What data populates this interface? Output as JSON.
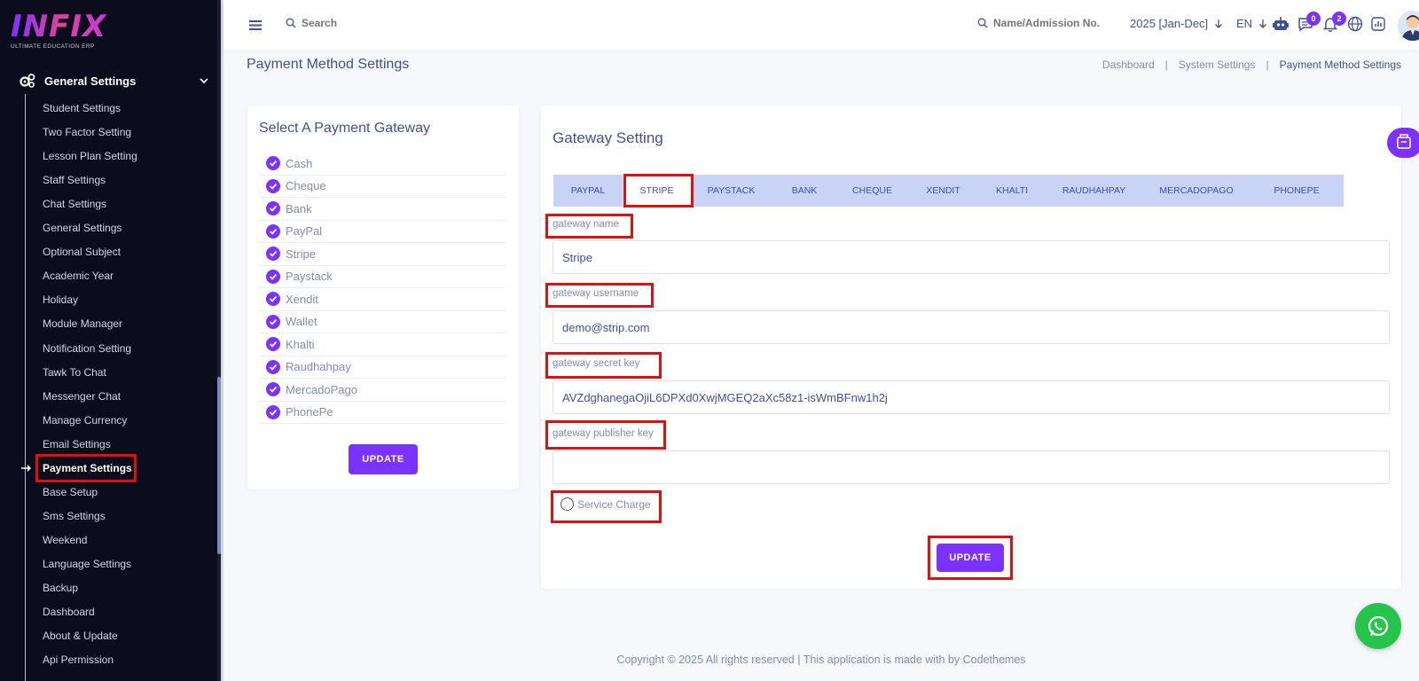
{
  "sidebar": {
    "logo_text": "INFIX",
    "logo_sub": "ULTIMATE EDUCATION ERP",
    "group_label": "General Settings",
    "items": [
      "Student Settings",
      "Two Factor Setting",
      "Lesson Plan Setting",
      "Staff Settings",
      "Chat Settings",
      "General Settings",
      "Optional Subject",
      "Academic Year",
      "Holiday",
      "Module Manager",
      "Notification Setting",
      "Tawk To Chat",
      "Messenger Chat",
      "Manage Currency",
      "Email Settings",
      "Payment Settings",
      "Base Setup",
      "Sms Settings",
      "Weekend",
      "Language Settings",
      "Backup",
      "Dashboard",
      "About & Update",
      "Api Permission"
    ],
    "active_item": "Payment Settings"
  },
  "topbar": {
    "search_placeholder": "Search",
    "search2_placeholder": "Name/Admission No.",
    "year": "2025 [Jan-Dec]",
    "lang": "EN",
    "chat_badge": "0",
    "notif_badge": "2"
  },
  "page": {
    "title": "Payment Method Settings",
    "breadcrumb": [
      "Dashboard",
      "System Settings",
      "Payment Method Settings"
    ]
  },
  "gateway_select": {
    "title": "Select A Payment Gateway",
    "gateways": [
      "Cash",
      "Cheque",
      "Bank",
      "PayPal",
      "Stripe",
      "Paystack",
      "Xendit",
      "Wallet",
      "Khalti",
      "Raudhahpay",
      "MercadoPago",
      "PhonePe"
    ],
    "update_label": "UPDATE"
  },
  "gateway_setting": {
    "title": "Gateway Setting",
    "tabs": [
      "PAYPAL",
      "STRIPE",
      "PAYSTACK",
      "BANK",
      "CHEQUE",
      "XENDIT",
      "KHALTI",
      "RAUDHAHPAY",
      "MERCADOPAGO",
      "PHONEPE"
    ],
    "active_tab": "STRIPE",
    "name_label": "gateway name",
    "name_value": "Stripe",
    "username_label": "gateway username",
    "username_value": "demo@strip.com",
    "secret_label": "gateway secret key",
    "secret_value": "AVZdghanegaOjiL6DPXd0XwjMGEQ2aXc58z1-isWmBFnw1h2j",
    "publisher_label": "gateway publisher key",
    "publisher_value": "",
    "service_charge_label": "Service Charge",
    "update_label": "UPDATE"
  },
  "footer": "Copyright © 2025 All rights reserved | This application is made with by Codethemes",
  "colors": {
    "primary": "#7c32ff",
    "sidebar_bg": "#0b0c1c",
    "highlight": "#e01010",
    "whatsapp": "#25c44a"
  }
}
